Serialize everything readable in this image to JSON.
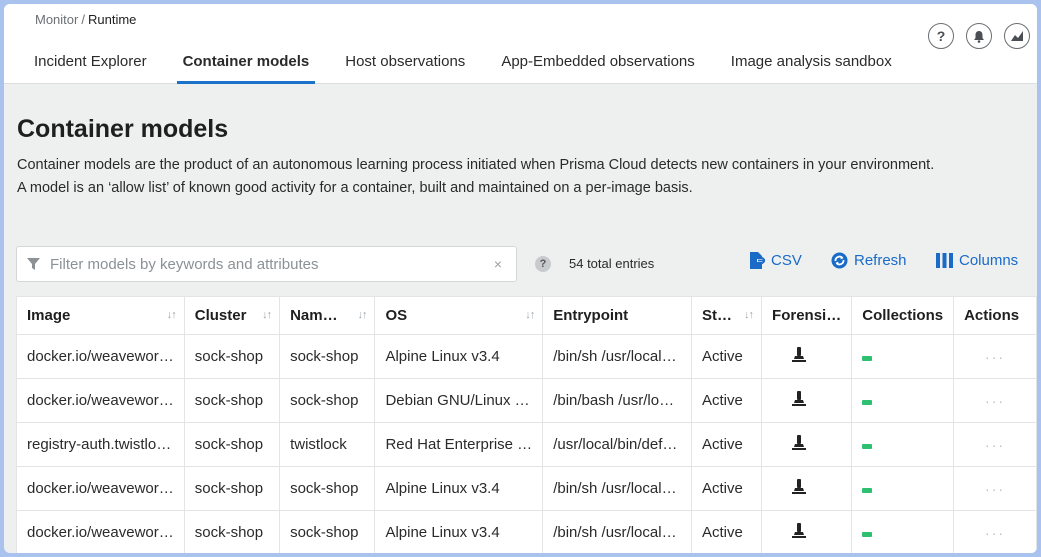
{
  "breadcrumb": {
    "parent": "Monitor",
    "separator": "/",
    "current": "Runtime"
  },
  "tabs": [
    {
      "label": "Incident Explorer",
      "active": false
    },
    {
      "label": "Container models",
      "active": true
    },
    {
      "label": "Host observations",
      "active": false
    },
    {
      "label": "App-Embedded observations",
      "active": false
    },
    {
      "label": "Image analysis sandbox",
      "active": false
    }
  ],
  "header_icons": {
    "help": "?",
    "bell": "bell-icon",
    "radar": "radar-icon"
  },
  "page": {
    "title": "Container models",
    "description_line1": "Container models are the product of an autonomous learning process initiated when Prisma Cloud detects new containers in your environment.",
    "description_line2": "A model is an ‘allow list’ of known good activity for a container, built and maintained on a per-image basis."
  },
  "toolbar": {
    "filter_placeholder": "Filter models by keywords and attributes",
    "clear_glyph": "×",
    "help_glyph": "?",
    "entries": "54 total entries",
    "csv_label": "CSV",
    "refresh_label": "Refresh",
    "columns_label": "Columns"
  },
  "table": {
    "headers": {
      "image": "Image",
      "cluster": "Cluster",
      "name": "Nam…",
      "os": "OS",
      "entrypoint": "Entrypoint",
      "state": "St…",
      "forensics": "Forensi…",
      "collections": "Collections",
      "actions": "Actions"
    },
    "rows": [
      {
        "image": "docker.io/weavewor…",
        "cluster": "sock-shop",
        "name": "sock-shop",
        "os": "Alpine Linux v3.4",
        "entrypoint": "/bin/sh /usr/local…",
        "state": "Active",
        "actions": "···"
      },
      {
        "image": "docker.io/weavewor…",
        "cluster": "sock-shop",
        "name": "sock-shop",
        "os": "Debian GNU/Linux …",
        "entrypoint": "/bin/bash /usr/lo…",
        "state": "Active",
        "actions": "···"
      },
      {
        "image": "registry-auth.twistlo…",
        "cluster": "sock-shop",
        "name": "twistlock",
        "os": "Red Hat Enterprise …",
        "entrypoint": "/usr/local/bin/def…",
        "state": "Active",
        "actions": "···"
      },
      {
        "image": "docker.io/weavewor…",
        "cluster": "sock-shop",
        "name": "sock-shop",
        "os": "Alpine Linux v3.4",
        "entrypoint": "/bin/sh /usr/local…",
        "state": "Active",
        "actions": "···"
      },
      {
        "image": "docker.io/weavewor…",
        "cluster": "sock-shop",
        "name": "sock-shop",
        "os": "Alpine Linux v3.4",
        "entrypoint": "/bin/sh /usr/local…",
        "state": "Active",
        "actions": "···"
      }
    ]
  },
  "colors": {
    "accent": "#1a6ac8",
    "collection": "#2fbf71",
    "frame": "#a9c2ee"
  }
}
